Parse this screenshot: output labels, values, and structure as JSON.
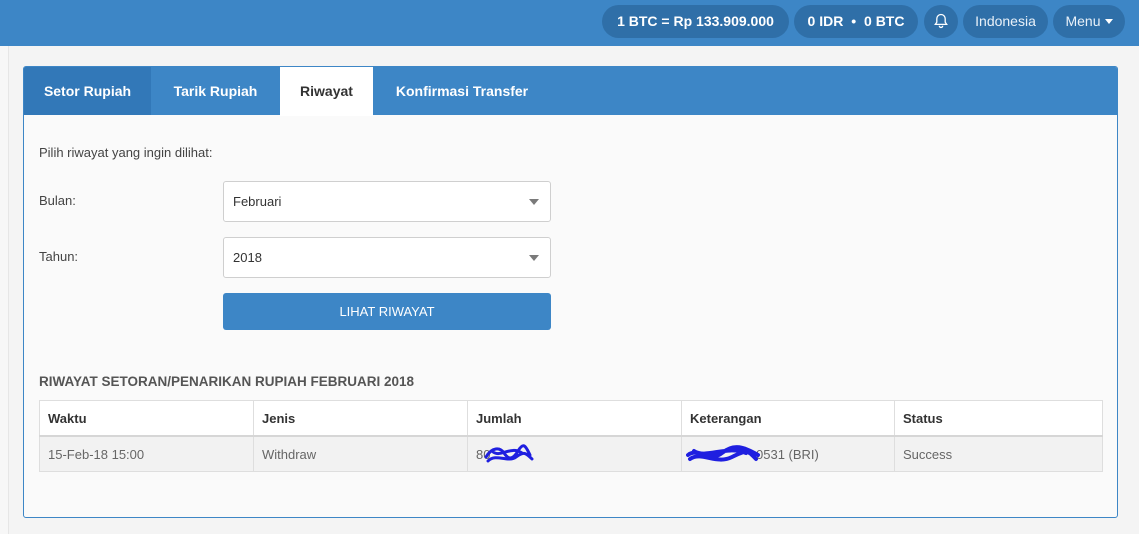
{
  "topbar": {
    "rate_label": "1 BTC = Rp 133.909.000",
    "balance_idr": "0 IDR",
    "balance_sep": "•",
    "balance_btc": "0 BTC",
    "language_label": "Indonesia",
    "menu_label": "Menu"
  },
  "tabs": [
    {
      "label": "Setor Rupiah"
    },
    {
      "label": "Tarik Rupiah"
    },
    {
      "label": "Riwayat",
      "active": true
    },
    {
      "label": "Konfirmasi Transfer"
    }
  ],
  "form": {
    "intro": "Pilih riwayat yang ingin dilihat:",
    "month_label": "Bulan:",
    "month_value": "Februari",
    "year_label": "Tahun:",
    "year_value": "2018",
    "submit_label": "LIHAT RIWAYAT"
  },
  "history": {
    "title": "RIWAYAT SETORAN/PENARIKAN RUPIAH FEBRUARI 2018",
    "columns": [
      "Waktu",
      "Jenis",
      "Jumlah",
      "Keterangan",
      "Status"
    ],
    "rows": [
      {
        "waktu": "15-Feb-18 15:00",
        "jenis": "Withdraw",
        "jumlah": "80",
        "keterangan": "0531 (BRI)",
        "status": "Success"
      }
    ]
  },
  "colors": {
    "primary": "#3d86c6",
    "primary_dark": "#2f6fa8",
    "redaction": "#1f1fe0"
  }
}
